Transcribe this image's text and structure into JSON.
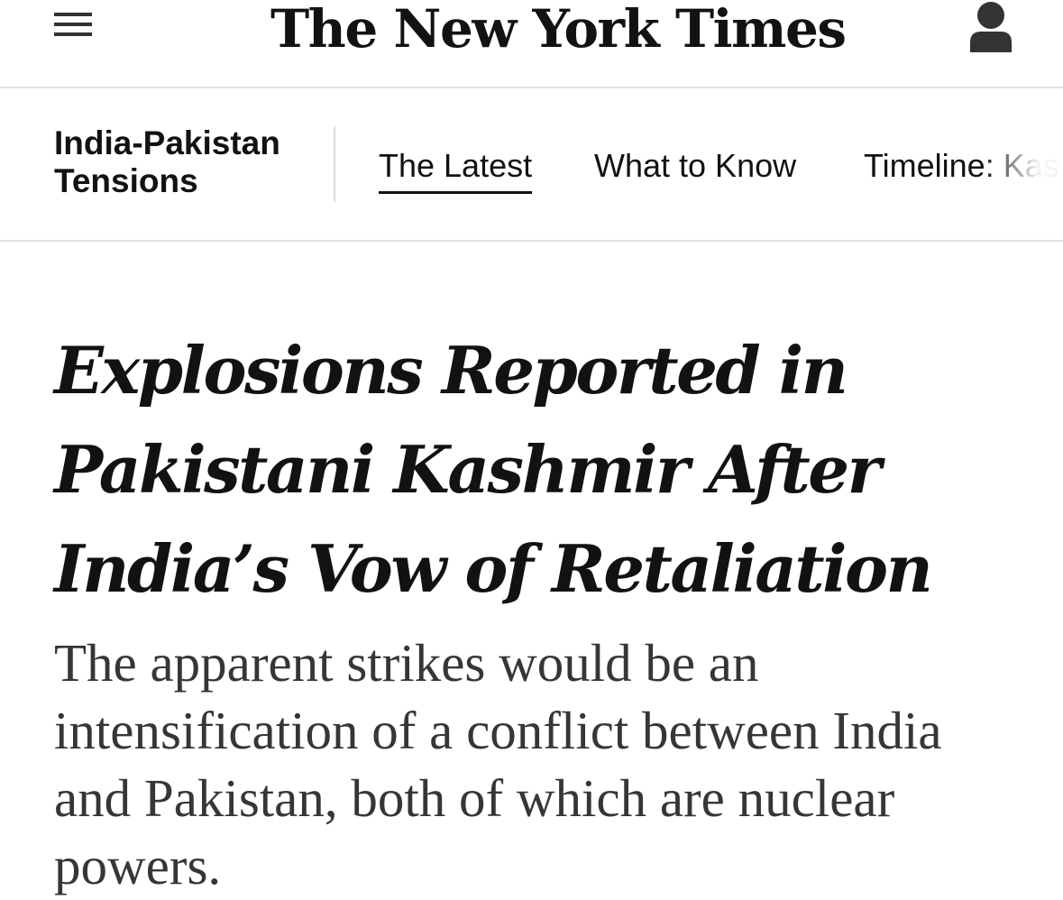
{
  "masthead": {
    "logo_text": "The New York Times",
    "menu_icon": "hamburger-menu-icon",
    "account_icon": "user-account-icon"
  },
  "section_nav": {
    "label": "India-Pakistan Tensions",
    "tabs": [
      {
        "label": "The Latest",
        "active": true
      },
      {
        "label": "What to Know",
        "active": false
      },
      {
        "label": "Timeline: Kas",
        "active": false
      }
    ]
  },
  "article": {
    "headline": "Explosions Reported in Pakistani Kashmir After India’s Vow of Retaliation",
    "summary": "The apparent strikes would be an intensification of a conflict between India and Pakistan, both of which are nuclear powers."
  }
}
